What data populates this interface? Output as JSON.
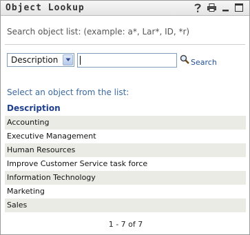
{
  "window": {
    "title": "Object Lookup",
    "icons": [
      "help-icon",
      "print-icon",
      "minimize-icon",
      "maximize-icon"
    ]
  },
  "search": {
    "hint": "Search object list: (example: a*, Lar*, ID, *r)",
    "field_select_value": "Description",
    "query_value": "",
    "button_label": "Search"
  },
  "list": {
    "prompt": "Select an object from the list:",
    "column_header": "Description",
    "rows": [
      "Accounting",
      "Executive Management",
      "Human Resources",
      "Improve Customer Service task force",
      "Information Technology",
      "Marketing",
      "Sales"
    ]
  },
  "pager": {
    "text": "1 - 7 of 7"
  },
  "colors": {
    "link": "#1f4e96",
    "header": "#1f3f8f",
    "row_alt": "#ebebe6"
  }
}
